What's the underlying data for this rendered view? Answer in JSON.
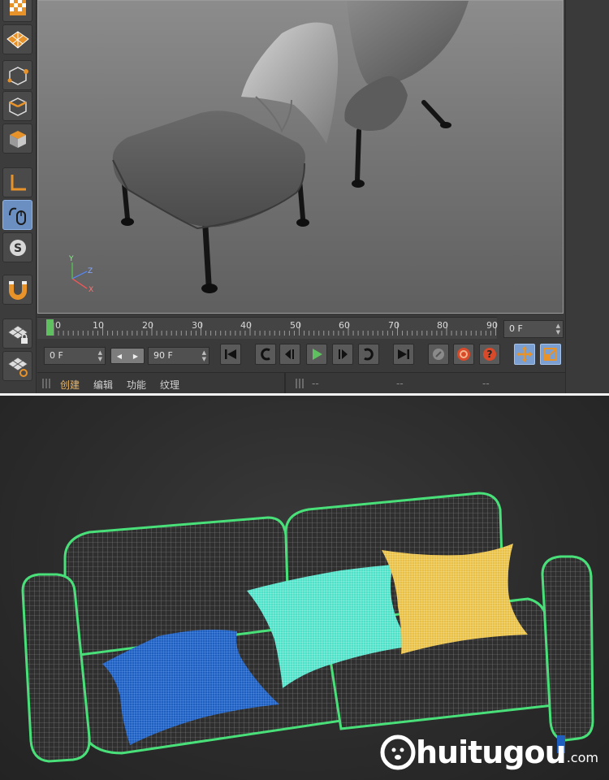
{
  "timeline": {
    "ticks": [
      "0",
      "10",
      "20",
      "30",
      "40",
      "50",
      "60",
      "70",
      "80",
      "90"
    ],
    "current_frame": "0 F"
  },
  "transport": {
    "start_frame": "0 F",
    "end_frame": "90 F"
  },
  "bottom_menu": {
    "create": "创建",
    "edit": "编辑",
    "function": "功能",
    "texture": "纹理"
  },
  "attributes_panel": {
    "field1": "--",
    "field2": "--",
    "field3": "--"
  },
  "axis_gizmo": {
    "x": "X",
    "y": "Y",
    "z": "Z"
  },
  "watermark": {
    "brand": "huitugou",
    "domain": ".com"
  },
  "colors": {
    "accent_orange": "#e8922a",
    "play_green": "#5fc060",
    "wire_green": "#49e07a",
    "pillow_blue": "#1f5fc0",
    "pillow_cyan": "#4fe0c8",
    "pillow_yellow": "#e8c048"
  }
}
